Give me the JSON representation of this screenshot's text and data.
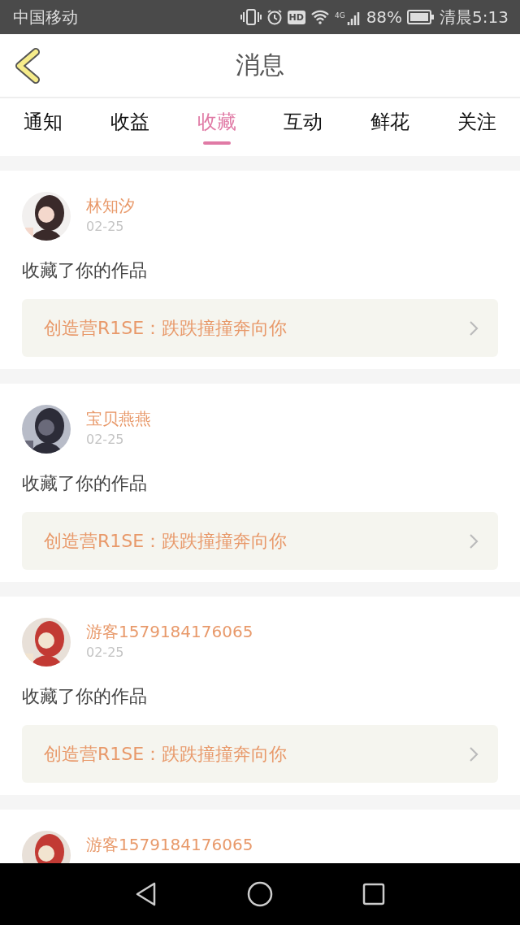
{
  "status_bar": {
    "carrier": "中国移动",
    "hd": "HD",
    "network": "4G",
    "battery": "88%",
    "time": "清晨5:13"
  },
  "header": {
    "title": "消息"
  },
  "tabs": [
    {
      "label": "通知",
      "selected": false
    },
    {
      "label": "收益",
      "selected": false
    },
    {
      "label": "收藏",
      "selected": true
    },
    {
      "label": "互动",
      "selected": false
    },
    {
      "label": "鲜花",
      "selected": false
    },
    {
      "label": "关注",
      "selected": false
    }
  ],
  "messages": [
    {
      "name": "林知汐",
      "date": "02-25",
      "text": "收藏了你的作品",
      "work": "创造营R1SE：跌跌撞撞奔向你"
    },
    {
      "name": "宝贝燕燕",
      "date": "02-25",
      "text": "收藏了你的作品",
      "work": "创造营R1SE：跌跌撞撞奔向你"
    },
    {
      "name": "游客1579184176065",
      "date": "02-25",
      "text": "收藏了你的作品",
      "work": "创造营R1SE：跌跌撞撞奔向你"
    },
    {
      "name": "游客1579184176065"
    }
  ]
}
